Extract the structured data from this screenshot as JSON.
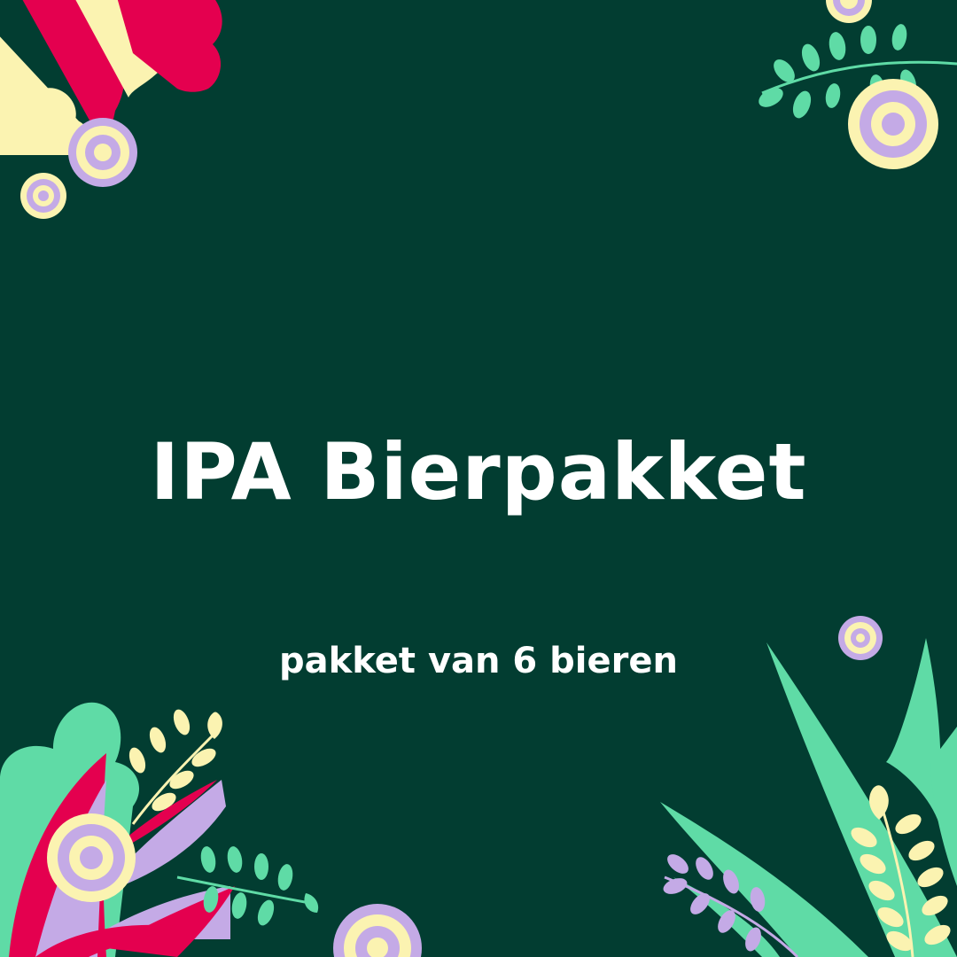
{
  "title": "IPA Bierpakket",
  "subtitle": "pakket van 6 bieren",
  "colors": {
    "background": "#023d31",
    "text": "#ffffff",
    "pink": "#e4004f",
    "cream": "#fbf3b1",
    "lavender": "#c4aae6",
    "mint": "#5fdba6"
  },
  "decorations": [
    "top-left-petal-cluster-icon",
    "top-right-fern-icon",
    "bottom-left-flower-cluster-icon",
    "bottom-right-leaf-cluster-icon",
    "concentric-circle-icon"
  ]
}
